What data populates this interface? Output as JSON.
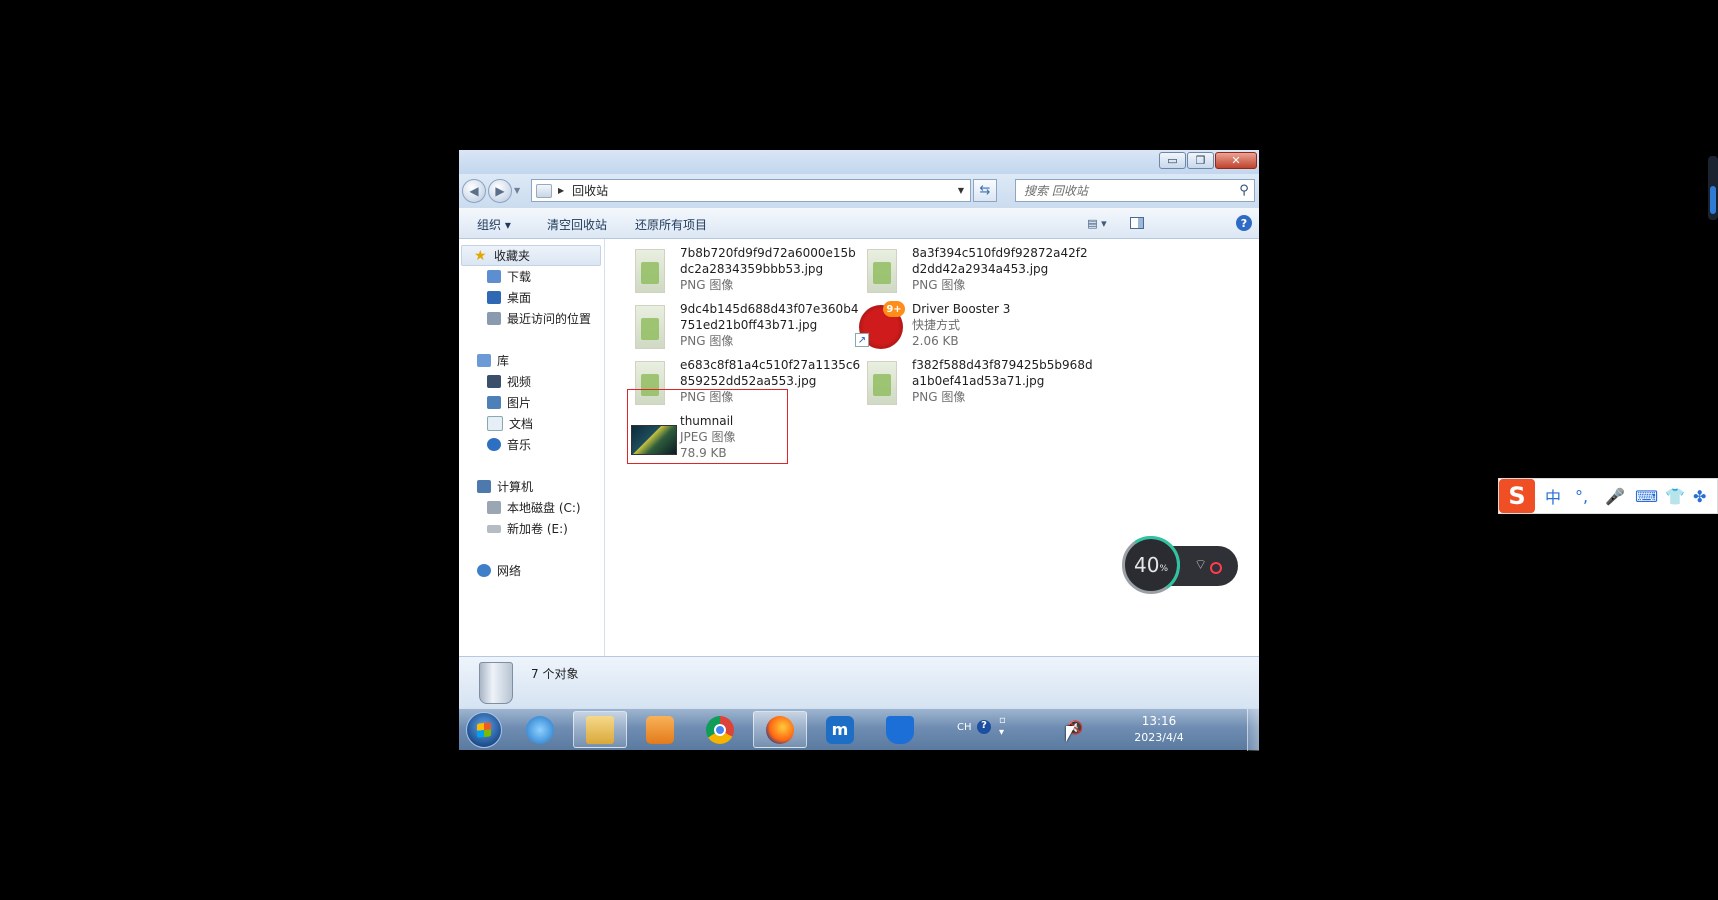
{
  "window": {
    "title_buttons": {
      "minimize": "▭",
      "maximize": "❐",
      "close": "✕"
    },
    "address": {
      "location": "回收站",
      "icon": "recycle-bin-small-icon"
    },
    "search": {
      "placeholder": "搜索 回收站"
    },
    "toolbar": {
      "organize": "组织 ▾",
      "empty_bin": "清空回收站",
      "restore_all": "还原所有项目",
      "view_icon": "▤ ▾"
    },
    "nav_pane": {
      "favorites": "收藏夹",
      "fav_items": [
        "下载",
        "桌面",
        "最近访问的位置"
      ],
      "libraries": "库",
      "lib_items": [
        "视频",
        "图片",
        "文档",
        "音乐"
      ],
      "computer": "计算机",
      "comp_items": [
        "本地磁盘 (C:)",
        "新加卷 (E:)"
      ],
      "network": "网络"
    },
    "files": [
      {
        "name": "7b8b720fd9f9d72a6000e15bdc2a2834359bbb53.jpg",
        "type": "PNG 图像"
      },
      {
        "name": "8a3f394c510fd9f92872a42f2d2dd42a2934a453.jpg",
        "type": "PNG 图像"
      },
      {
        "name": "9dc4b145d688d43f07e360b4751ed21b0ff43b71.jpg",
        "type": "PNG 图像"
      },
      {
        "name": "Driver Booster 3",
        "type": "快捷方式",
        "size": "2.06 KB",
        "badge": "9+"
      },
      {
        "name": "e683c8f81a4c510f27a1135c6859252dd52aa553.jpg",
        "type": "PNG 图像"
      },
      {
        "name": "f382f588d43f879425b5b968da1b0ef41ad53a71.jpg",
        "type": "PNG 图像"
      },
      {
        "name": "thumnail",
        "type": "JPEG 图像",
        "size": "78.9 KB"
      }
    ],
    "details": {
      "count": "7 个对象"
    }
  },
  "taskbar": {
    "apps": [
      "internet-explorer",
      "windows-explorer",
      "media-player",
      "chrome",
      "firefox",
      "maxthon",
      "security-shield"
    ],
    "maxthon_glyph": "m",
    "tray": {
      "lang": "CH",
      "help": "?",
      "time": "13:16",
      "date": "2023/4/4"
    }
  },
  "overlays": {
    "speed_percent": "40",
    "speed_unit": "%",
    "ime": {
      "logo": "S",
      "mode": "中",
      "punct": "°,",
      "mic": "🎤",
      "keyboard": "⌨",
      "skin": "👕",
      "tools": "✤"
    }
  },
  "colors": {
    "selection_border": "#e0252a",
    "taskbar": "#6f8db2"
  }
}
